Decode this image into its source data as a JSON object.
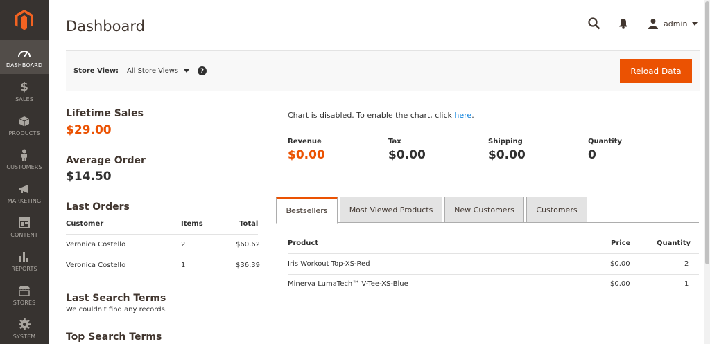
{
  "sidebar": {
    "items": [
      {
        "label": "Dashboard",
        "icon": "dashboard-icon"
      },
      {
        "label": "Sales",
        "icon": "dollar-icon"
      },
      {
        "label": "Products",
        "icon": "cube-icon"
      },
      {
        "label": "Customers",
        "icon": "person-icon"
      },
      {
        "label": "Marketing",
        "icon": "megaphone-icon"
      },
      {
        "label": "Content",
        "icon": "layout-icon"
      },
      {
        "label": "Reports",
        "icon": "bar-chart-icon"
      },
      {
        "label": "Stores",
        "icon": "storefront-icon"
      },
      {
        "label": "System",
        "icon": "gear-icon"
      }
    ]
  },
  "header": {
    "title": "Dashboard",
    "user": "admin"
  },
  "store_view": {
    "label": "Store View:",
    "value": "All Store Views",
    "help": "?",
    "reload_label": "Reload Data"
  },
  "lifetime_sales": {
    "label": "Lifetime Sales",
    "value": "$29.00"
  },
  "average_order": {
    "label": "Average Order",
    "value": "$14.50"
  },
  "last_orders": {
    "title": "Last Orders",
    "columns": [
      "Customer",
      "Items",
      "Total"
    ],
    "rows": [
      {
        "customer": "Veronica Costello",
        "items": "2",
        "total": "$60.62"
      },
      {
        "customer": "Veronica Costello",
        "items": "1",
        "total": "$36.39"
      }
    ]
  },
  "last_search_terms": {
    "title": "Last Search Terms",
    "empty": "We couldn't find any records."
  },
  "top_search_terms": {
    "title": "Top Search Terms"
  },
  "chart": {
    "message": "Chart is disabled. To enable the chart, click",
    "link": "here",
    "suffix": "."
  },
  "totals": [
    {
      "label": "Revenue",
      "value": "$0.00"
    },
    {
      "label": "Tax",
      "value": "$0.00"
    },
    {
      "label": "Shipping",
      "value": "$0.00"
    },
    {
      "label": "Quantity",
      "value": "0"
    }
  ],
  "tabs": [
    {
      "label": "Bestsellers"
    },
    {
      "label": "Most Viewed Products"
    },
    {
      "label": "New Customers"
    },
    {
      "label": "Customers"
    }
  ],
  "bestsellers": {
    "columns": [
      "Product",
      "Price",
      "Quantity"
    ],
    "rows": [
      {
        "product": "Iris Workout Top-XS-Red",
        "price": "$0.00",
        "quantity": "2"
      },
      {
        "product": "Minerva LumaTech™ V-Tee-XS-Blue",
        "price": "$0.00",
        "quantity": "1"
      }
    ]
  },
  "colors": {
    "accent": "#eb5202",
    "sidebar": "#373330",
    "link": "#007bdb"
  }
}
